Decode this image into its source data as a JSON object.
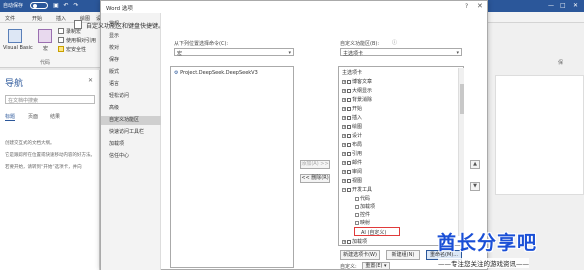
{
  "word": {
    "autosave": "自动保存",
    "tabs": [
      "文件",
      "开始",
      "插入",
      "绘图",
      "设"
    ],
    "ribbon": {
      "visual_basic": "Visual Basic",
      "macros": "宏",
      "record_macro": "录制宏",
      "relative_ref": "使用相对引用",
      "macro_security": "宏安全性",
      "group_label": "代码"
    },
    "nav": {
      "title": "导航",
      "search_placeholder": "在文档中搜索",
      "tabs": [
        "标题",
        "页面",
        "结果"
      ],
      "body_lines": [
        "创建交互式的文档大纲。",
        "它是跟踪所在位置或快速移动内容的好方法。",
        "若要开始，请转到“开始”选项卡，并向"
      ]
    },
    "right_group_label": "保"
  },
  "dialog": {
    "title": "Word 选项",
    "help": "?",
    "sidebar": [
      "常规",
      "显示",
      "校对",
      "保存",
      "版式",
      "语言",
      "轻松访问",
      "高级",
      "自定义功能区",
      "快速访问工具栏",
      "加载项",
      "信任中心"
    ],
    "selected_sidebar_index": 8,
    "header": "自定义功能区和键盘快捷键。",
    "choose_label": "从下列位置选择命令(C):",
    "choose_value": "宏",
    "customize_label": "自定义功能区(B):",
    "customize_value": "主选项卡",
    "macro_list": [
      "Project.DeepSeek.DeepSeekV3"
    ],
    "add_button": "添加(A) >>",
    "remove_button": "<< 删除(R)",
    "tree": [
      "主选项卡",
      "博客文章",
      "大纲显示",
      "背景消除",
      "开始",
      "插入",
      "绘图",
      "设计",
      "布局",
      "引用",
      "邮件",
      "审阅",
      "视图",
      "开发工具"
    ],
    "dev_children": [
      "代码",
      "加载项",
      "控件",
      "映射",
      "保护",
      "模板"
    ],
    "ai_custom": "AI (自定义)",
    "after_tree": "加载项",
    "new_tab_button": "新建选项卡(W)",
    "new_group_button": "新建组(N)",
    "rename_button": "重命名(M)...",
    "customize_label2": "自定义:",
    "reset_button": "重置(E) ▾"
  },
  "watermark": {
    "main": "酋长分享吧",
    "sub": "——专注您关注的游戏资讯——"
  },
  "colors": {
    "word_blue": "#2b579a",
    "watermark_blue": "#1a4fd6",
    "highlight_red": "#e03b3b"
  }
}
